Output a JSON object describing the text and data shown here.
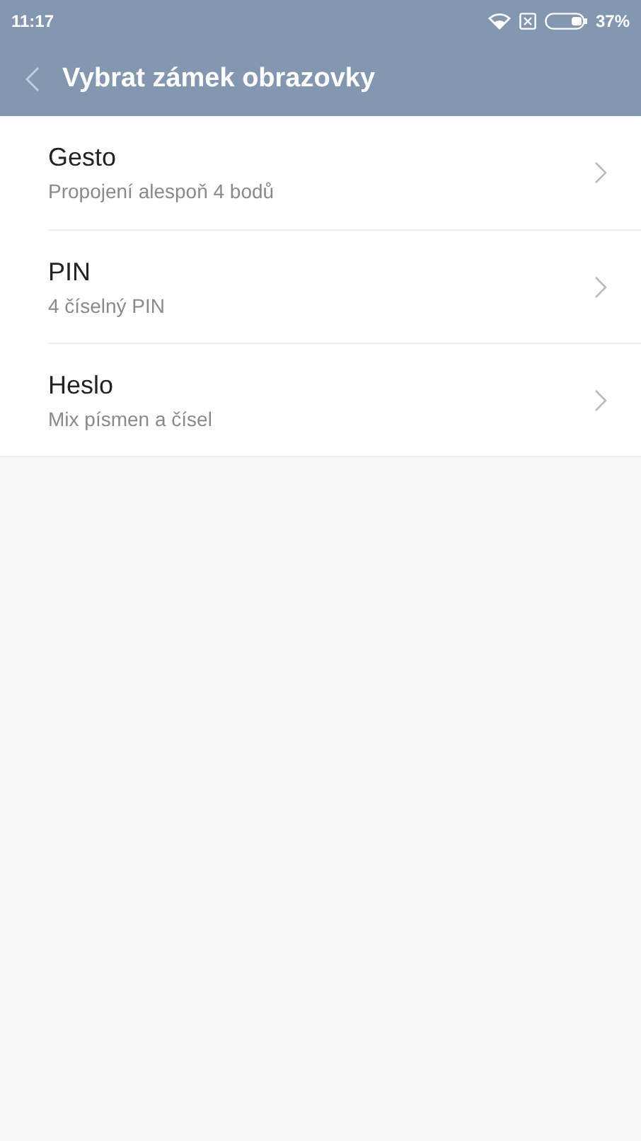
{
  "status_bar": {
    "time": "11:17",
    "battery_text": "37%"
  },
  "header": {
    "title": "Vybrat zámek obrazovky"
  },
  "options": [
    {
      "title": "Gesto",
      "subtitle": "Propojení alespoň 4 bodů"
    },
    {
      "title": "PIN",
      "subtitle": "4 číselný PIN"
    },
    {
      "title": "Heslo",
      "subtitle": "Mix písmen a čísel"
    }
  ]
}
